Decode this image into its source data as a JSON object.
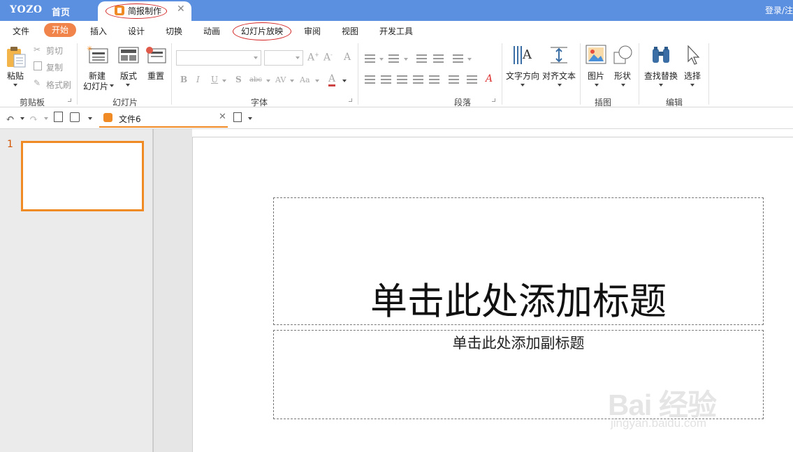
{
  "titlebar": {
    "logo": "YOZO",
    "home_tab": "首页",
    "doc_tab": "简报制作",
    "close_glyph": "✕",
    "login": "登录/注"
  },
  "menu": {
    "items": [
      "文件",
      "开始",
      "插入",
      "设计",
      "切换",
      "动画",
      "幻灯片放映",
      "审阅",
      "视图",
      "开发工具"
    ],
    "active_index": 1
  },
  "ribbon": {
    "clipboard": {
      "group": "剪贴板",
      "paste": "粘贴",
      "cut": "剪切",
      "copy": "复制",
      "format_painter": "格式刷"
    },
    "slides": {
      "group": "幻灯片",
      "new_slide_1": "新建",
      "new_slide_2": "幻灯片",
      "layout": "版式",
      "reset": "重置"
    },
    "font": {
      "group": "字体",
      "font_name": "",
      "font_size": ""
    },
    "paragraph": {
      "group": "段落"
    },
    "misc": {
      "text_direction": "文字方向",
      "align_text": "对齐文本"
    },
    "insert": {
      "group": "插图",
      "picture": "图片",
      "shape": "形状"
    },
    "edit": {
      "group": "编辑",
      "find_replace": "查找替换",
      "select": "选择"
    }
  },
  "quickbar": {
    "file_tab": "文件6",
    "close_glyph": "✕"
  },
  "slide_panel": {
    "slide_number": "1"
  },
  "slide": {
    "title_placeholder": "单击此处添加标题",
    "subtitle_placeholder": "单击此处添加副标题"
  },
  "watermark": {
    "text": "Bai 经验",
    "url": "jingyan.baidu.com"
  },
  "colors": {
    "titlebar": "#5b8fe0",
    "accent": "#f08a24",
    "annotation": "#d32222"
  }
}
